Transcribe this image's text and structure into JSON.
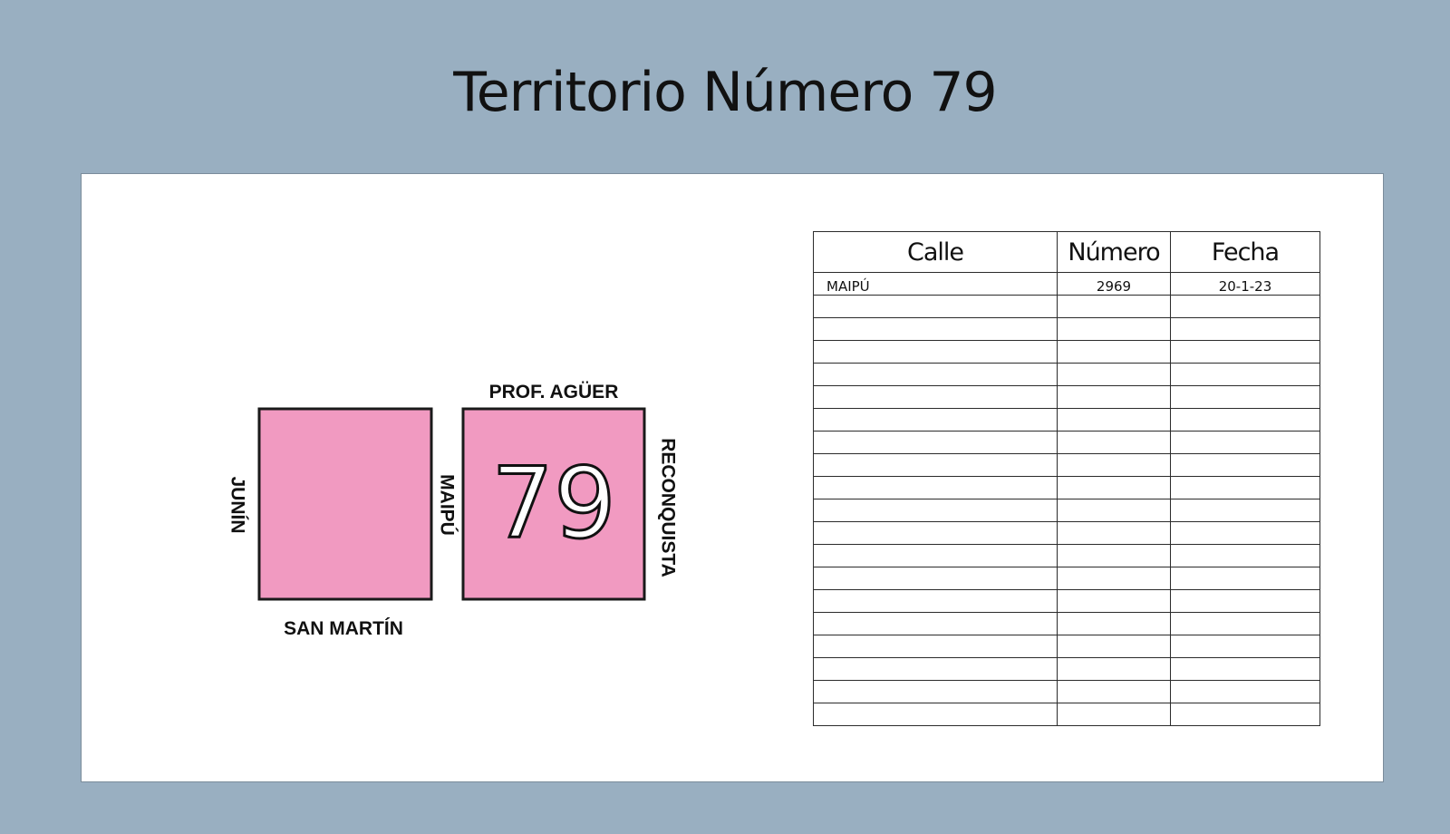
{
  "page": {
    "title": "Territorio Número 79",
    "frame_color": "#99afc1",
    "panel_color": "#ffffff"
  },
  "map": {
    "territory_number": "79",
    "block_color": "#f19ac1",
    "streets": {
      "north": "PROF. AGÜER",
      "south": "SAN MARTÍN",
      "west": "JUNÍN",
      "middle": "MAIPÚ",
      "east": "RECONQUISTA"
    }
  },
  "table": {
    "headers": [
      "Calle",
      "Número",
      "Fecha"
    ],
    "rows": [
      [
        "MAIPÚ",
        "2969",
        "20-1-23"
      ],
      [
        "",
        "",
        ""
      ],
      [
        "",
        "",
        ""
      ],
      [
        "",
        "",
        ""
      ],
      [
        "",
        "",
        ""
      ],
      [
        "",
        "",
        ""
      ],
      [
        "",
        "",
        ""
      ],
      [
        "",
        "",
        ""
      ],
      [
        "",
        "",
        ""
      ],
      [
        "",
        "",
        ""
      ],
      [
        "",
        "",
        ""
      ],
      [
        "",
        "",
        ""
      ],
      [
        "",
        "",
        ""
      ],
      [
        "",
        "",
        ""
      ],
      [
        "",
        "",
        ""
      ],
      [
        "",
        "",
        ""
      ],
      [
        "",
        "",
        ""
      ],
      [
        "",
        "",
        ""
      ],
      [
        "",
        "",
        ""
      ],
      [
        "",
        "",
        ""
      ]
    ]
  }
}
